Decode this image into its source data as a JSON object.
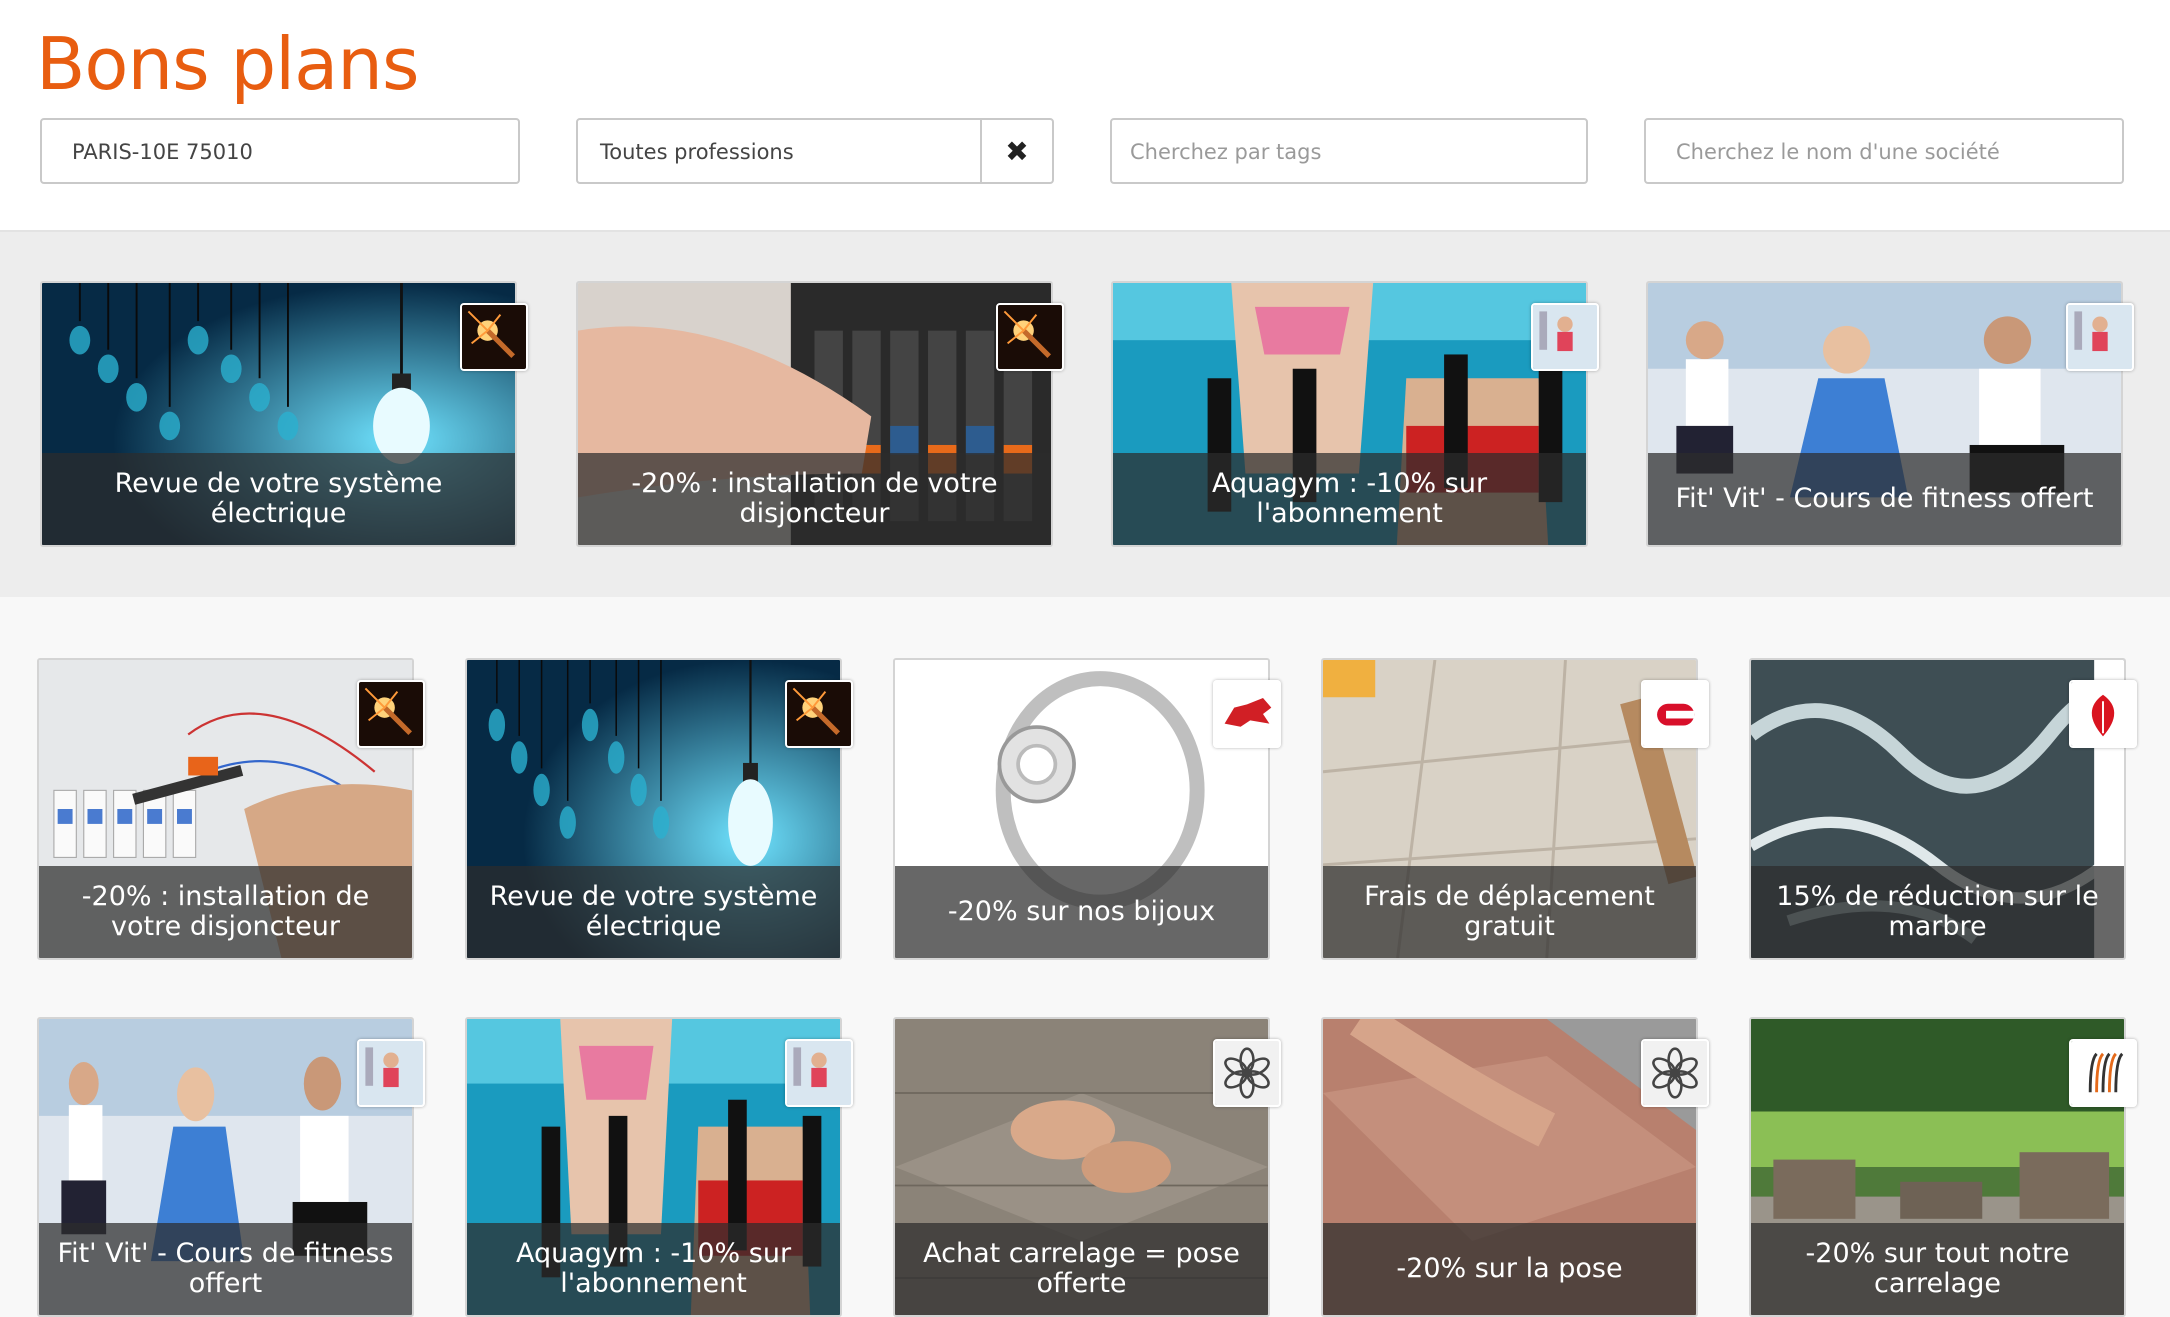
{
  "page": {
    "title": "Bons plans"
  },
  "filters": {
    "location_value": "PARIS-10E 75010",
    "profession_value": "Toutes professions",
    "clear_icon": "close-icon",
    "tags_placeholder": "Cherchez par tags",
    "company_placeholder": "Cherchez le nom d'une société"
  },
  "featured": [
    {
      "caption": "Revue de votre système électrique",
      "image": "light-bulbs",
      "badge": "sparkler-icon"
    },
    {
      "caption": "-20% : installation de votre disjoncteur",
      "image": "breaker-hand",
      "badge": "sparkler-icon"
    },
    {
      "caption": "Aquagym : -10% sur l'abonnement",
      "image": "aquagym",
      "badge": "fitness-icon"
    },
    {
      "caption": "Fit' Vit' - Cours de fitness offert",
      "image": "fitness-class",
      "badge": "fitness-icon"
    }
  ],
  "deals": [
    {
      "caption": "-20% : installation de votre disjoncteur",
      "image": "electric-panel",
      "badge": "sparkler-icon"
    },
    {
      "caption": "Revue de votre système électrique",
      "image": "light-bulbs",
      "badge": "sparkler-icon"
    },
    {
      "caption": "-20% sur nos bijoux",
      "image": "ring",
      "badge": "bull-logo-icon"
    },
    {
      "caption": "Frais de déplacement gratuit",
      "image": "tiles-caulk",
      "badge": "red-c-logo-icon"
    },
    {
      "caption": "15% de réduction sur le marbre",
      "image": "marble",
      "badge": "red-leaf-logo-icon"
    },
    {
      "caption": "Fit' Vit' - Cours de fitness offert",
      "image": "fitness-class",
      "badge": "fitness-icon"
    },
    {
      "caption": "Aquagym : -10% sur l'abonnement",
      "image": "aquagym",
      "badge": "fitness-icon"
    },
    {
      "caption": "Achat carrelage = pose offerte",
      "image": "tiling-hands",
      "badge": "flower-logo-icon"
    },
    {
      "caption": "-20% sur la pose",
      "image": "floor-tiling",
      "badge": "flower-logo-icon"
    },
    {
      "caption": "-20% sur tout notre carrelage",
      "image": "garden-terrace",
      "badge": "stripes-logo-icon"
    }
  ]
}
